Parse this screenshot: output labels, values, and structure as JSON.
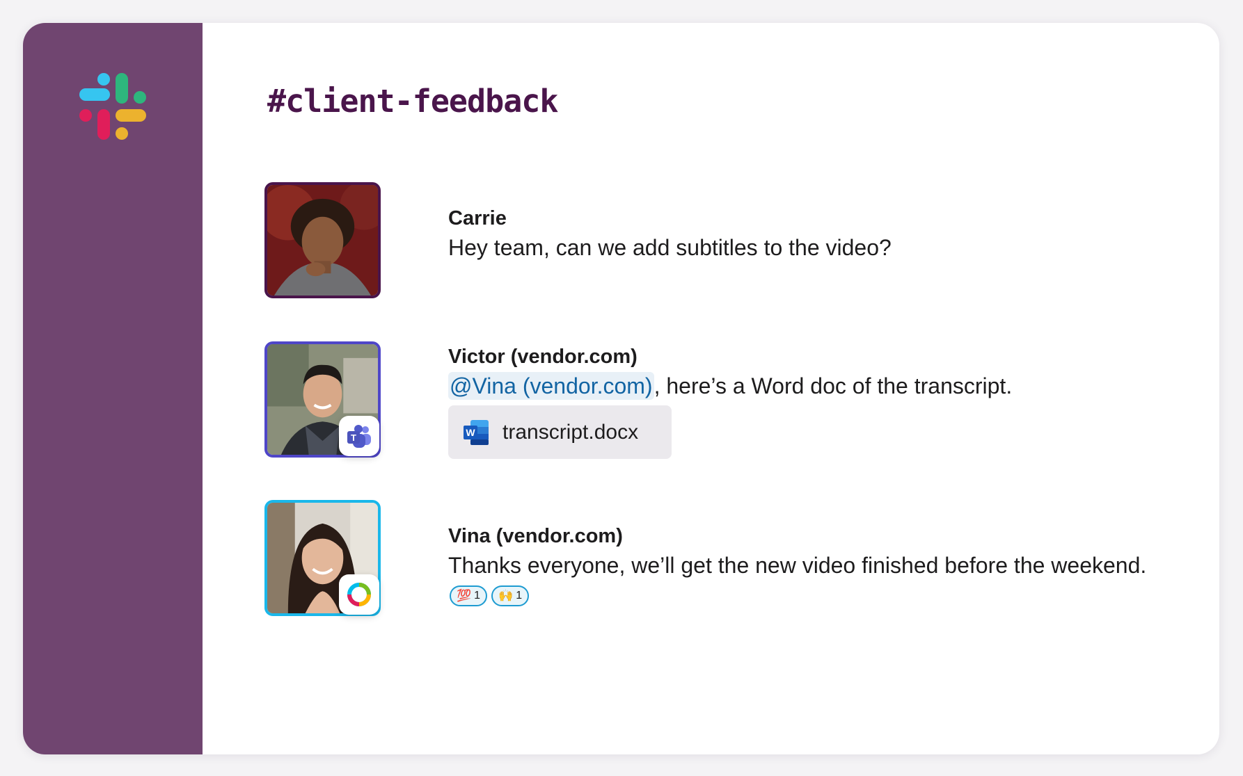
{
  "channel": {
    "name": "#client-feedback"
  },
  "brand_colors": {
    "aubergine": "#704570",
    "title": "#4a154b",
    "mention_blue": "#1264a3"
  },
  "messages": [
    {
      "author": "Carrie",
      "text": "Hey team, can we add subtitles to the video?",
      "avatar_border": "#4a154b",
      "app_badge": null
    },
    {
      "author": "Victor (vendor.com)",
      "mention": "@Vina (vendor.com)",
      "text": ", here’s a Word doc of the transcript.",
      "avatar_border": "#4f46c8",
      "app_badge": "teams-icon",
      "attachment": {
        "name": "transcript.docx",
        "icon": "word-icon"
      }
    },
    {
      "author": "Vina (vendor.com)",
      "text": "Thanks everyone, we’ll get the new video finished before the weekend.",
      "avatar_border": "#1ab7ea",
      "app_badge": "webex-icon",
      "reactions": [
        {
          "emoji": "💯",
          "count": "1"
        },
        {
          "emoji": "🙌",
          "count": "1"
        }
      ]
    }
  ]
}
